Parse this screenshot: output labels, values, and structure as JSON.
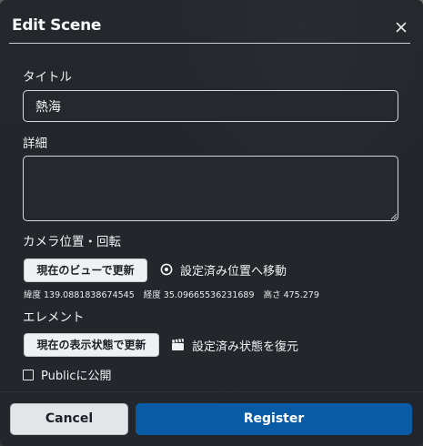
{
  "dialog": {
    "title": "Edit Scene",
    "close_icon": "close-icon"
  },
  "fields": {
    "title_label": "タイトル",
    "title_value": "熱海",
    "detail_label": "詳細",
    "detail_value": ""
  },
  "camera": {
    "section_label": "カメラ位置・回転",
    "update_button_label": "現在のビューで更新",
    "move_link_label": "設定済み位置へ移動",
    "move_icon": "target-icon",
    "coords": {
      "latitude_label": "緯度",
      "latitude_value": "139.0881838674545",
      "longitude_label": "経度",
      "longitude_value": "35.09665536231689",
      "height_label": "高さ",
      "height_value": "475.279"
    }
  },
  "elements": {
    "section_label": "エレメント",
    "update_button_label": "現在の表示状態で更新",
    "restore_link_label": "設定済み状態を復元",
    "restore_icon": "clapperboard-icon"
  },
  "public": {
    "label": "Publicに公開",
    "checked": false
  },
  "footer": {
    "cancel_label": "Cancel",
    "register_label": "Register"
  },
  "colors": {
    "dialog_bg": "#22252a",
    "primary": "#0a5ba6",
    "secondary_button_bg": "#e3e6e9"
  }
}
